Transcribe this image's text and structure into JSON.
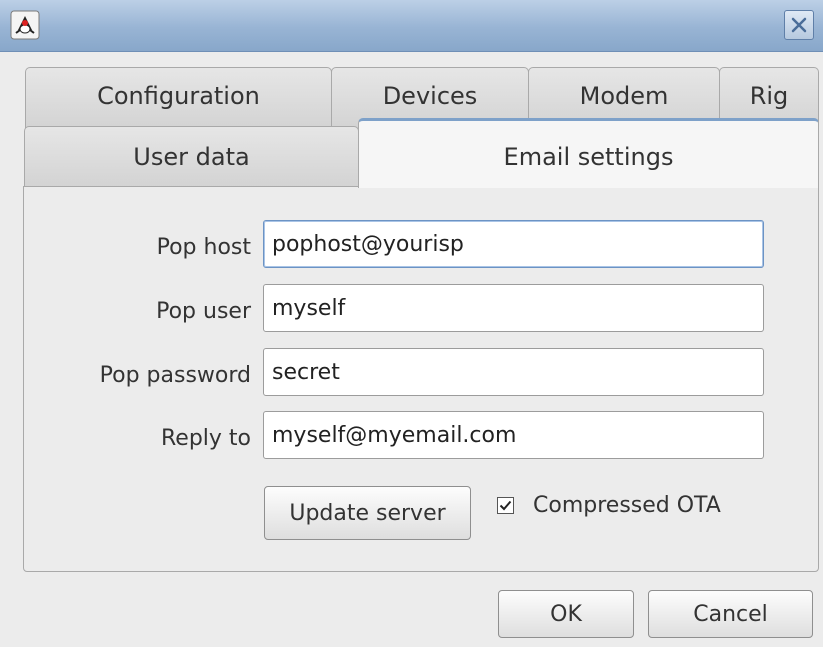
{
  "window": {
    "icon": "java-duke-icon",
    "close_icon": "close-icon"
  },
  "tabs_row1": [
    {
      "label": "Configuration"
    },
    {
      "label": "Devices"
    },
    {
      "label": "Modem"
    },
    {
      "label": "Rig"
    }
  ],
  "tabs_row2": [
    {
      "label": "User data",
      "selected": false
    },
    {
      "label": "Email settings",
      "selected": true
    }
  ],
  "form": {
    "pop_host": {
      "label": "Pop host",
      "value": "pophost@yourisp"
    },
    "pop_user": {
      "label": "Pop user",
      "value": "myself"
    },
    "pop_password": {
      "label": "Pop password",
      "value": "secret"
    },
    "reply_to": {
      "label": "Reply to",
      "value": "myself@myemail.com"
    }
  },
  "update_server_label": "Update server",
  "compressed_ota": {
    "label": "Compressed OTA",
    "checked": true
  },
  "dialog_buttons": {
    "ok": "OK",
    "cancel": "Cancel"
  },
  "colors": {
    "titlebar": "#98b4d4",
    "tab_accent": "#7ea1c9"
  }
}
